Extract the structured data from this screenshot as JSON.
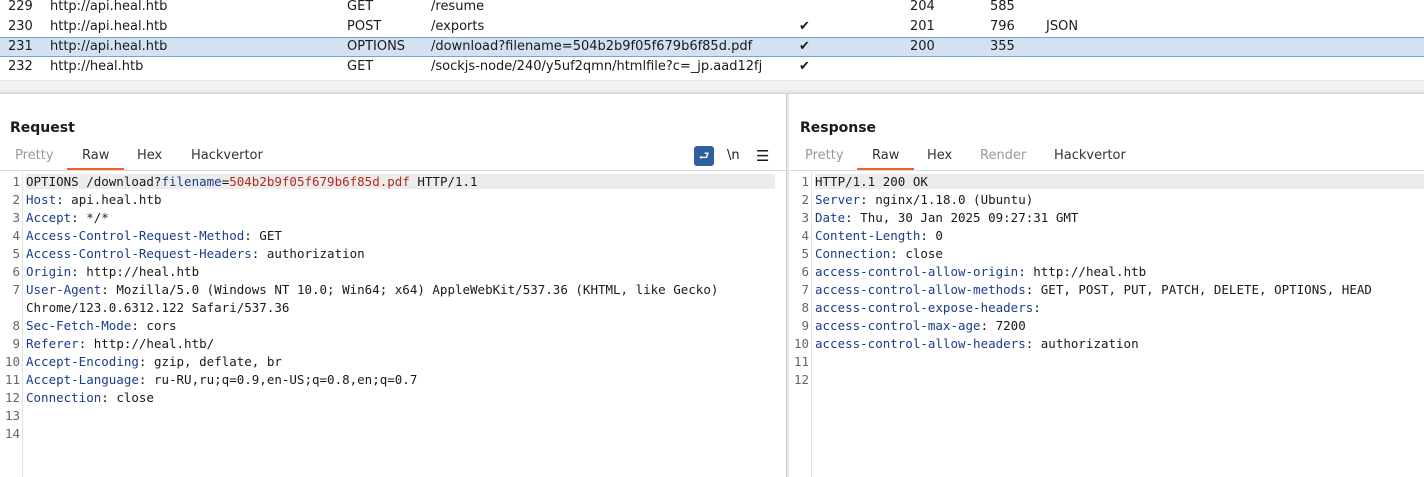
{
  "history": {
    "rows": [
      {
        "id": "229",
        "host": "http://api.heal.htb",
        "method": "GET",
        "url": "/resume",
        "edited": "",
        "status": "204",
        "length": "585",
        "mime": ""
      },
      {
        "id": "230",
        "host": "http://api.heal.htb",
        "method": "POST",
        "url": "/exports",
        "edited": "✔",
        "status": "201",
        "length": "796",
        "mime": "JSON"
      },
      {
        "id": "231",
        "host": "http://api.heal.htb",
        "method": "OPTIONS",
        "url": "/download?filename=504b2b9f05f679b6f85d.pdf",
        "edited": "✔",
        "status": "200",
        "length": "355",
        "mime": ""
      },
      {
        "id": "232",
        "host": "http://heal.htb",
        "method": "GET",
        "url": "/sockjs-node/240/y5uf2qmn/htmlfile?c=_jp.aad12fj",
        "edited": "✔",
        "status": "",
        "length": "",
        "mime": ""
      }
    ],
    "selected_id": "231"
  },
  "request": {
    "title": "Request",
    "tabs": [
      "Pretty",
      "Raw",
      "Hex",
      "Hackvertor"
    ],
    "active_tab": "Raw",
    "tool_newline": "\\n",
    "line_numbers": [
      "1",
      "2",
      "3",
      "4",
      "5",
      "6",
      "7",
      "8",
      "9",
      "10",
      "11",
      "12",
      "13",
      "14"
    ],
    "request_line": {
      "prefix": "OPTIONS /download?",
      "param": "filename",
      "eq": "=",
      "value": "504b2b9f05f679b6f85d.pdf",
      "suffix": " HTTP/1.1"
    },
    "headers": [
      {
        "k": "Host",
        "v": " api.heal.htb"
      },
      {
        "k": "Accept",
        "v": " */*"
      },
      {
        "k": "Access-Control-Request-Method",
        "v": " GET"
      },
      {
        "k": "Access-Control-Request-Headers",
        "v": " authorization"
      },
      {
        "k": "Origin",
        "v": " http://heal.htb"
      },
      {
        "k": "User-Agent",
        "v": " Mozilla/5.0 (Windows NT 10.0; Win64; x64) AppleWebKit/537.36 (KHTML, like Gecko)"
      },
      {
        "k": "",
        "v": "Chrome/123.0.6312.122 Safari/537.36"
      },
      {
        "k": "Sec-Fetch-Mode",
        "v": " cors"
      },
      {
        "k": "Referer",
        "v": " http://heal.htb/"
      },
      {
        "k": "Accept-Encoding",
        "v": " gzip, deflate, br"
      },
      {
        "k": "Accept-Language",
        "v": " ru-RU,ru;q=0.9,en-US;q=0.8,en;q=0.7"
      },
      {
        "k": "Connection",
        "v": " close"
      }
    ]
  },
  "response": {
    "title": "Response",
    "tabs": [
      "Pretty",
      "Raw",
      "Hex",
      "Render",
      "Hackvertor"
    ],
    "active_tab": "Raw",
    "line_numbers": [
      "1",
      "2",
      "3",
      "4",
      "5",
      "6",
      "7",
      "8",
      "9",
      "10",
      "11",
      "12"
    ],
    "status_line": "HTTP/1.1 200 OK",
    "headers": [
      {
        "k": "Server",
        "v": " nginx/1.18.0 (Ubuntu)"
      },
      {
        "k": "Date",
        "v": " Thu, 30 Jan 2025 09:27:31 GMT"
      },
      {
        "k": "Content-Length",
        "v": " 0"
      },
      {
        "k": "Connection",
        "v": " close"
      },
      {
        "k": "access-control-allow-origin",
        "v": " http://heal.htb"
      },
      {
        "k": "access-control-allow-methods",
        "v": " GET, POST, PUT, PATCH, DELETE, OPTIONS, HEAD"
      },
      {
        "k": "access-control-expose-headers",
        "v": ""
      },
      {
        "k": "access-control-max-age",
        "v": " 7200"
      },
      {
        "k": "access-control-allow-headers",
        "v": " authorization"
      }
    ]
  }
}
